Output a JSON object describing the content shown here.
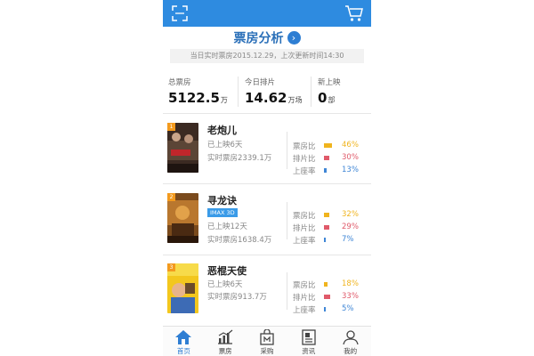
{
  "header": {
    "scan_icon": "scan-icon",
    "cart_icon": "cart-icon",
    "title": "票房分析",
    "title_arrow": "›",
    "subtitle": "当日实时票房2015.12.29，上次更新时间14:30"
  },
  "stats": [
    {
      "label": "总票房",
      "value": "5122.5",
      "unit": "万"
    },
    {
      "label": "今日排片",
      "value": "14.62",
      "unit": "万场"
    },
    {
      "label": "新上映",
      "value": "0",
      "unit": "部"
    }
  ],
  "ratio_labels": {
    "box": "票房比",
    "schedule": "排片比",
    "seat": "上座率"
  },
  "colors": {
    "box": "#f0b41e",
    "schedule": "#e05a6a",
    "seat": "#3f86d6",
    "brand": "#2e8be0"
  },
  "movies": [
    {
      "rank": "1",
      "name": "老炮儿",
      "tag": "",
      "days": "已上映6天",
      "realtime": "实时票房2339.1万",
      "box_ratio": "46%",
      "box_fraction": 0.46,
      "schedule_ratio": "30%",
      "schedule_fraction": 0.3,
      "seat_ratio": "13%",
      "seat_fraction": 0.13
    },
    {
      "rank": "2",
      "name": "寻龙诀",
      "tag": "IMAX 3D",
      "days": "已上映12天",
      "realtime": "实时票房1638.4万",
      "box_ratio": "32%",
      "box_fraction": 0.32,
      "schedule_ratio": "29%",
      "schedule_fraction": 0.29,
      "seat_ratio": "7%",
      "seat_fraction": 0.07
    },
    {
      "rank": "3",
      "name": "恶棍天使",
      "tag": "",
      "days": "已上映6天",
      "realtime": "实时票房913.7万",
      "box_ratio": "18%",
      "box_fraction": 0.18,
      "schedule_ratio": "33%",
      "schedule_fraction": 0.33,
      "seat_ratio": "5%",
      "seat_fraction": 0.05
    }
  ],
  "nav": [
    {
      "label": "首页",
      "icon": "home-icon",
      "active": true
    },
    {
      "label": "票房",
      "icon": "chart-icon",
      "active": false
    },
    {
      "label": "采购",
      "icon": "bag-icon",
      "active": false
    },
    {
      "label": "资讯",
      "icon": "news-icon",
      "active": false
    },
    {
      "label": "我的",
      "icon": "user-icon",
      "active": false
    }
  ]
}
